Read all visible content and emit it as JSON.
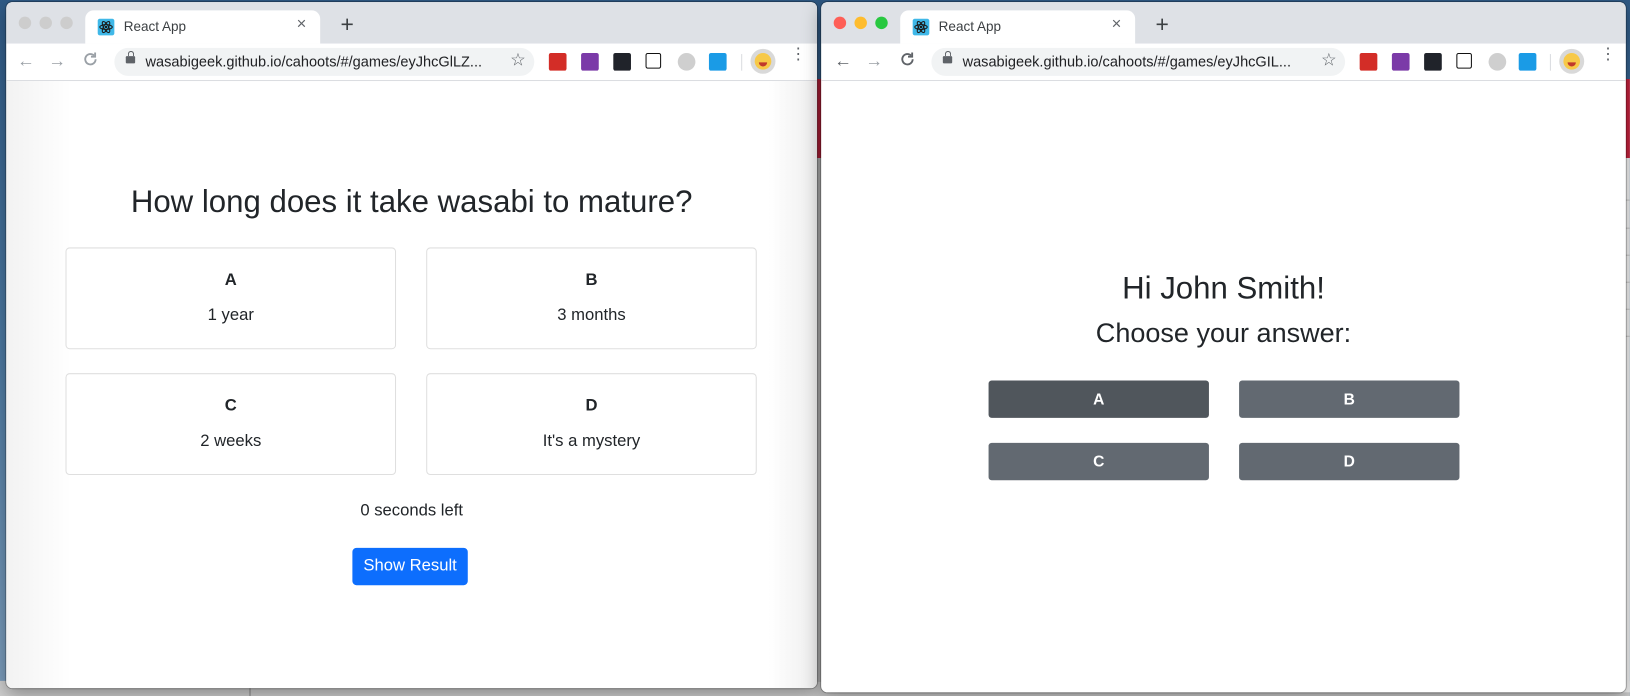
{
  "colors": {
    "primary": "#0d6efd",
    "choice_button": "#626971",
    "choice_button_active": "#50565c",
    "text": "#212529"
  },
  "windows": {
    "left": {
      "tab_title": "React App",
      "tab_icon": "react-icon",
      "url": "wasabigeek.github.io/cahoots/#/games/eyJhcGlLZ...",
      "content": {
        "question": "How long does it take wasabi to mature?",
        "answers": [
          {
            "letter": "A",
            "text": "1 year"
          },
          {
            "letter": "B",
            "text": "3 months"
          },
          {
            "letter": "C",
            "text": "2 weeks"
          },
          {
            "letter": "D",
            "text": "It's a mystery"
          }
        ],
        "timer_text": "0 seconds left",
        "show_result_label": "Show Result"
      }
    },
    "right": {
      "tab_title": "React App",
      "tab_icon": "react-icon",
      "url": "wasabigeek.github.io/cahoots/#/games/eyJhcGIL...",
      "content": {
        "greeting": "Hi John Smith!",
        "prompt": "Choose your answer:",
        "choices": [
          {
            "label": "A",
            "state": "active"
          },
          {
            "label": "B",
            "state": "normal"
          },
          {
            "label": "C",
            "state": "normal"
          },
          {
            "label": "D",
            "state": "normal"
          }
        ]
      }
    }
  },
  "browser": {
    "new_tab_symbol": "+",
    "close_tab_symbol": "×",
    "back_symbol": "←",
    "forward_symbol": "→",
    "reload_symbol": "C",
    "star_symbol": "☆",
    "menu_symbol": "⋮",
    "extensions": [
      {
        "name": "lastpass-extension-icon",
        "color": "#d32d27"
      },
      {
        "name": "onenote-extension-icon",
        "color": "#7b3aa8"
      },
      {
        "name": "react-devtools-extension-icon",
        "color": "#20232a"
      },
      {
        "name": "notion-extension-icon",
        "color": "#ffffff"
      },
      {
        "name": "bulb-extension-icon",
        "color": "#c8c8c8"
      },
      {
        "name": "screenshot-extension-icon",
        "color": "#1a9be6"
      }
    ]
  }
}
